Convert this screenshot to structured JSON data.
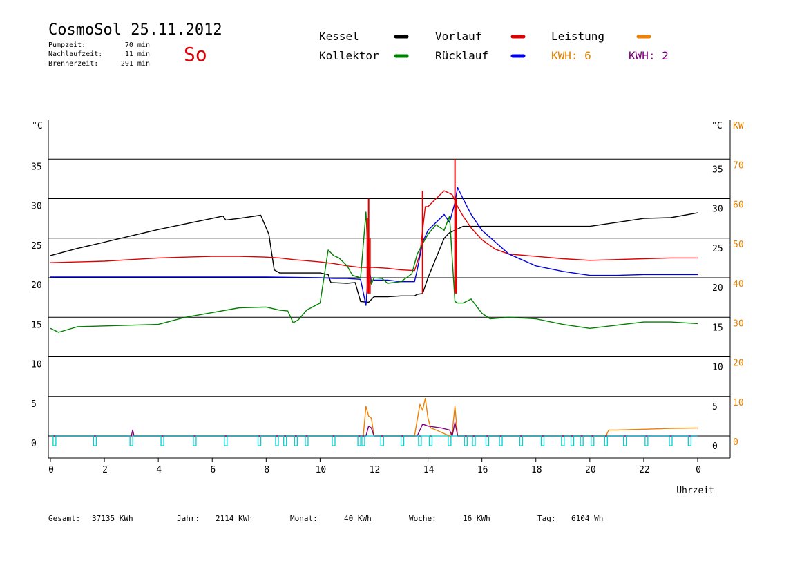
{
  "header": {
    "title": "CosmoSol 25.11.2012",
    "day": "So",
    "info": [
      {
        "label": "Pumpzeit:",
        "value": "70 min"
      },
      {
        "label": "Nachlaufzeit:",
        "value": "11 min"
      },
      {
        "label": "Brennerzeit:",
        "value": "291 min"
      }
    ]
  },
  "legend": {
    "kessel": {
      "label": "Kessel",
      "color": "#000000"
    },
    "kollektor": {
      "label": "Kollektor",
      "color": "#008000"
    },
    "vorlauf": {
      "label": "Vorlauf",
      "color": "#e00000"
    },
    "ruecklauf": {
      "label": "Rücklauf",
      "color": "#0000e0"
    },
    "leistung": {
      "label": "Leistung",
      "color": "#f08000"
    },
    "kwh1": {
      "label": "KWH: 6",
      "color": "#e08000"
    },
    "kwh2": {
      "label": "KWH: 2",
      "color": "#800080"
    }
  },
  "axes": {
    "left_unit": "°C",
    "right_unit": "°C",
    "kw_unit": "KW",
    "x_label": "Uhrzeit",
    "x_ticks": [
      "0",
      "2",
      "4",
      "6",
      "8",
      "10",
      "12",
      "14",
      "16",
      "18",
      "20",
      "22",
      "0"
    ],
    "y_ticks": [
      "0",
      "5",
      "10",
      "15",
      "20",
      "25",
      "30",
      "35"
    ],
    "kw_ticks": [
      "0",
      "10",
      "20",
      "30",
      "40",
      "50",
      "60",
      "70"
    ]
  },
  "footer": [
    {
      "label": "Gesamt:",
      "value": "37135 KWh"
    },
    {
      "label": "Jahr:",
      "value": "2114 KWh"
    },
    {
      "label": "Monat:",
      "value": "40 KWh"
    },
    {
      "label": "Woche:",
      "value": "16 KWh"
    },
    {
      "label": "Tag:",
      "value": "6104 Wh"
    }
  ],
  "chart_data": {
    "type": "line",
    "x_unit": "hour",
    "xlim": [
      0,
      24
    ],
    "ylim": [
      0,
      40
    ],
    "y2lim": [
      0,
      80
    ],
    "grid": true,
    "series": [
      {
        "name": "Kessel",
        "color": "#000000",
        "x": [
          0,
          1,
          2,
          3,
          4,
          5,
          6,
          6.4,
          6.5,
          7,
          7.8,
          8.1,
          8.3,
          8.5,
          9,
          10,
          10.3,
          10.4,
          11,
          11.3,
          11.5,
          11.8,
          12,
          12.5,
          13,
          13.5,
          13.6,
          13.8,
          14,
          14.3,
          14.6,
          14.8,
          15,
          15.3,
          16,
          17,
          18,
          19,
          19.5,
          20,
          21,
          22,
          23,
          24
        ],
        "y": [
          22.8,
          23.7,
          24.5,
          25.3,
          26.1,
          26.8,
          27.5,
          27.8,
          27.3,
          27.5,
          27.9,
          25.5,
          21.0,
          20.6,
          20.6,
          20.6,
          20.4,
          19.4,
          19.3,
          19.4,
          17.0,
          16.9,
          17.6,
          17.6,
          17.7,
          17.7,
          17.9,
          18.0,
          20.0,
          22.5,
          25.0,
          25.7,
          26.0,
          26.5,
          26.5,
          26.5,
          26.5,
          26.5,
          26.5,
          26.5,
          27.0,
          27.5,
          27.6,
          28.2
        ]
      },
      {
        "name": "Vorlauf",
        "color": "#e00000",
        "x": [
          0,
          1,
          2,
          3,
          4,
          5,
          6,
          7,
          8,
          8.5,
          9,
          10,
          10.5,
          11,
          11.5,
          12,
          12.5,
          13,
          13.5,
          13.7,
          13.9,
          14,
          14.3,
          14.6,
          14.9,
          15.1,
          15.3,
          15.6,
          16,
          16.5,
          17,
          18,
          19,
          20,
          21,
          22,
          23,
          24
        ],
        "y": [
          21.9,
          22.0,
          22.1,
          22.3,
          22.5,
          22.6,
          22.7,
          22.7,
          22.6,
          22.5,
          22.3,
          22.0,
          21.8,
          21.5,
          21.3,
          21.3,
          21.2,
          21.0,
          20.9,
          23.0,
          29.0,
          29.0,
          30.0,
          31.0,
          30.5,
          29.0,
          27.8,
          26.3,
          24.8,
          23.6,
          23.0,
          22.7,
          22.4,
          22.2,
          22.3,
          22.4,
          22.5,
          22.5
        ]
      },
      {
        "name": "Rücklauf",
        "color": "#0000e0",
        "x": [
          0,
          2,
          4,
          6,
          8,
          10,
          10.5,
          11,
          11.5,
          11.7,
          11.8,
          11.9,
          12,
          12.5,
          13,
          13.5,
          13.6,
          13.8,
          14,
          14.3,
          14.6,
          14.8,
          15,
          15.1,
          15.3,
          15.6,
          16,
          16.5,
          17,
          18,
          19,
          20,
          21,
          22,
          23,
          24
        ],
        "y": [
          20.1,
          20.1,
          20.1,
          20.1,
          20.1,
          20.0,
          19.9,
          19.9,
          19.8,
          16.5,
          21.5,
          19.5,
          19.7,
          19.7,
          19.5,
          19.5,
          21.0,
          24.5,
          26.0,
          27.0,
          28.0,
          27.0,
          29.5,
          31.4,
          30.0,
          28.0,
          26.0,
          24.5,
          23.0,
          21.5,
          20.8,
          20.3,
          20.3,
          20.4,
          20.4,
          20.4
        ]
      },
      {
        "name": "Kollektor",
        "color": "#008000",
        "x": [
          0,
          0.3,
          1,
          2,
          3,
          4,
          5,
          6,
          7,
          8,
          8.5,
          8.8,
          9,
          9.2,
          9.5,
          10,
          10.3,
          10.5,
          10.7,
          11,
          11.2,
          11.5,
          11.7,
          11.8,
          11.9,
          12,
          12.3,
          12.5,
          13,
          13.4,
          13.6,
          13.8,
          14,
          14.3,
          14.6,
          14.8,
          15,
          15.1,
          15.3,
          15.6,
          16,
          16.3,
          17,
          18,
          19,
          20,
          21,
          22,
          23,
          24
        ],
        "y": [
          13.6,
          13.1,
          13.8,
          13.9,
          14.0,
          14.1,
          15.0,
          15.6,
          16.2,
          16.3,
          15.9,
          15.8,
          14.3,
          14.7,
          15.9,
          16.8,
          23.5,
          22.8,
          22.5,
          21.5,
          20.3,
          20.0,
          28.3,
          21.0,
          19.2,
          20.0,
          19.9,
          19.3,
          19.5,
          20.5,
          23.0,
          24.3,
          25.5,
          26.7,
          26.0,
          27.8,
          17.0,
          16.8,
          16.8,
          17.3,
          15.5,
          14.8,
          15.0,
          14.8,
          14.1,
          13.6,
          14.0,
          14.4,
          14.4,
          14.2
        ]
      },
      {
        "name": "Leistung",
        "color": "#f08000",
        "axis": "kw",
        "x": [
          0,
          11.6,
          11.7,
          11.8,
          11.9,
          12,
          13.5,
          13.7,
          13.8,
          13.9,
          14,
          14.1,
          14.3,
          14.8,
          14.9,
          15,
          15.1,
          20.6,
          20.7,
          21,
          22,
          23,
          24
        ],
        "y": [
          0,
          0,
          7.5,
          5.0,
          4.5,
          0,
          0,
          8.0,
          6.5,
          9.5,
          4.5,
          2.0,
          1.5,
          0,
          1.0,
          7.5,
          0,
          0,
          1.5,
          1.5,
          1.7,
          1.9,
          2.0
        ]
      },
      {
        "name": "Vorlauf",
        "color": "#e00000",
        "role": "spikes",
        "axis": "kw",
        "x": [
          11.7,
          11.75,
          11.8,
          11.85,
          13.75,
          13.8,
          14.95,
          15.0,
          15.05
        ],
        "y": [
          0,
          55,
          60,
          50,
          0,
          62,
          0,
          70,
          60
        ]
      },
      {
        "name": "KWH: 2",
        "color": "#800080",
        "axis": "kw",
        "x": [
          0,
          3.0,
          3.05,
          3.1,
          11.7,
          11.8,
          11.9,
          12.0,
          13.6,
          13.8,
          14.0,
          14.5,
          14.8,
          14.9,
          15,
          15.1,
          24
        ],
        "y": [
          0,
          0,
          1.5,
          0,
          0,
          2.5,
          2.0,
          0,
          0,
          3.0,
          2.5,
          2.0,
          1.5,
          0,
          3.5,
          0,
          0
        ]
      }
    ],
    "pump_pulses_hours": [
      0.1,
      1.6,
      2.95,
      4.1,
      5.3,
      6.45,
      7.7,
      8.35,
      8.65,
      9.05,
      9.45,
      10.45,
      11.4,
      11.55,
      12.25,
      13.0,
      13.65,
      14.05,
      14.75,
      15.35,
      15.65,
      16.15,
      16.65,
      17.4,
      18.2,
      18.95,
      19.3,
      19.65,
      20.05,
      20.55,
      21.25,
      22.05,
      22.95,
      23.65
    ]
  }
}
